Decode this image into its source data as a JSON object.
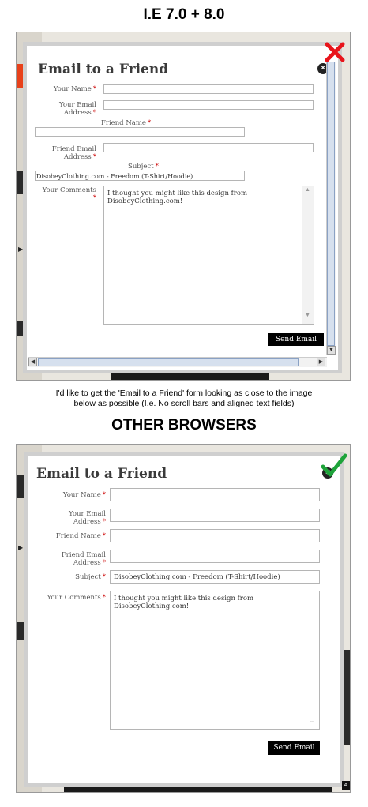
{
  "top_heading": "I.E 7.0 + 8.0",
  "caption_line1": "I'd like to get the 'Email to a Friend' form looking as close to the image",
  "caption_line2": "below as possible (I.e. No scroll bars and aligned text fields)",
  "bottom_heading": "OTHER BROWSERS",
  "form": {
    "title": "Email to a Friend",
    "your_name_label": "Your Name",
    "your_email_label_1": "Your Email",
    "your_email_label_2": "Address",
    "friend_name_label": "Friend Name",
    "friend_email_label_1": "Friend Email",
    "friend_email_label_2": "Address",
    "subject_label": "Subject",
    "comments_label": "Your Comments",
    "required_marker": "*",
    "subject_value": "DisobeyClothing.com - Freedom (T-Shirt/Hoodie)",
    "comments_line1": "I thought you might like this design from",
    "comments_line2": "DisobeyClothing.com!",
    "send_label": "Send Email"
  },
  "colors": {
    "required": "#cc0000",
    "ie_x_mark": "#e8141b",
    "check_mark": "#1ea33a",
    "button": "#000000"
  },
  "icons": [
    "close-icon",
    "red-x-mark-icon",
    "green-check-mark-icon",
    "chevron-up-icon",
    "chevron-down-icon",
    "chevron-left-icon",
    "chevron-right-icon",
    "resize-grip-icon"
  ],
  "ie_subject_value_clipped": "DisobeyClothing.com - Freedom (T-Shirt/Hoodie)"
}
